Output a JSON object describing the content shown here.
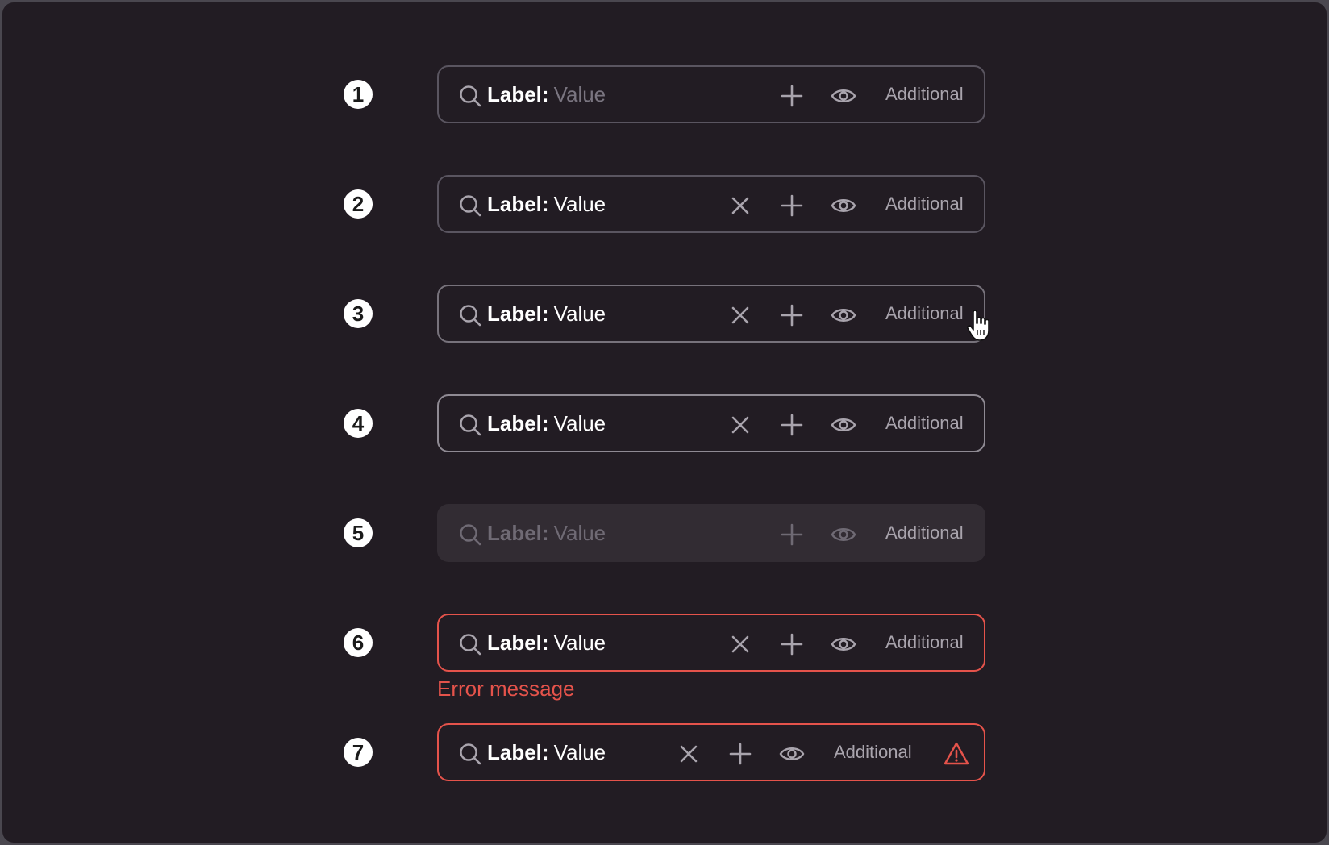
{
  "rows": [
    {
      "number": "1",
      "label": "Label:",
      "value": "Value",
      "additional": "Additional",
      "state": "empty"
    },
    {
      "number": "2",
      "label": "Label:",
      "value": "Value",
      "additional": "Additional",
      "state": "filled"
    },
    {
      "number": "3",
      "label": "Label:",
      "value": "Value",
      "additional": "Additional",
      "state": "hover"
    },
    {
      "number": "4",
      "label": "Label:",
      "value": "Value",
      "additional": "Additional",
      "state": "focus"
    },
    {
      "number": "5",
      "label": "Label:",
      "value": "Value",
      "additional": "Additional",
      "state": "disabled"
    },
    {
      "number": "6",
      "label": "Label:",
      "value": "Value",
      "additional": "Additional",
      "state": "error"
    },
    {
      "number": "7",
      "label": "Label:",
      "value": "Value",
      "additional": "Additional",
      "state": "error-icon"
    }
  ],
  "error_message": "Error message",
  "icons": {
    "search": "search-icon",
    "clear": "close-icon",
    "add": "plus-icon",
    "view": "eye-icon",
    "warning": "warning-triangle-icon",
    "pointer": "hand-cursor-icon"
  },
  "colors": {
    "background": "#221c23",
    "border": "#5a5560",
    "error": "#e5534b",
    "text": "#ffffff",
    "muted": "#a9a4ad"
  }
}
